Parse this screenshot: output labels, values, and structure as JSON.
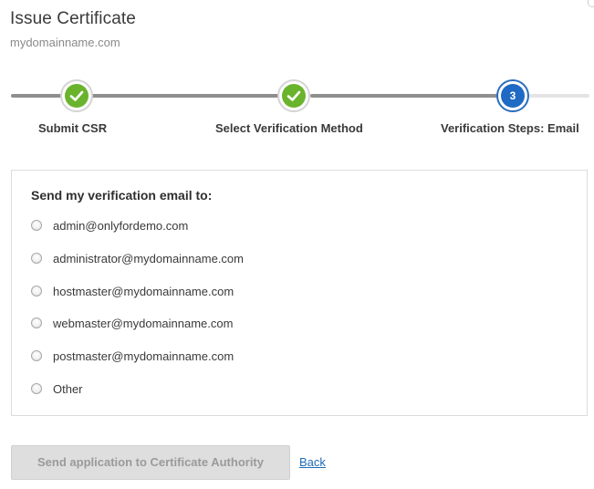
{
  "header": {
    "title": "Issue Certificate",
    "domain": "mydomainname.com"
  },
  "stepper": {
    "steps": [
      {
        "label": "Submit CSR",
        "status": "complete",
        "icon": "check-icon"
      },
      {
        "label": "Select Verification Method",
        "status": "complete",
        "icon": "check-icon"
      },
      {
        "label": "Verification Steps: Email",
        "status": "current",
        "number": "3"
      }
    ]
  },
  "verification": {
    "heading": "Send my verification email to:",
    "options": [
      {
        "label": "admin@onlyfordemo.com",
        "selected": false
      },
      {
        "label": "administrator@mydomainname.com",
        "selected": false
      },
      {
        "label": "hostmaster@mydomainname.com",
        "selected": false
      },
      {
        "label": "webmaster@mydomainname.com",
        "selected": false
      },
      {
        "label": "postmaster@mydomainname.com",
        "selected": false
      },
      {
        "label": "Other",
        "selected": false
      }
    ]
  },
  "actions": {
    "send_label": "Send application to Certificate Authority",
    "send_disabled": true,
    "back_label": "Back"
  },
  "colors": {
    "complete": "#6ab42d",
    "current": "#1f6ac4",
    "link": "#1e6bb8"
  }
}
